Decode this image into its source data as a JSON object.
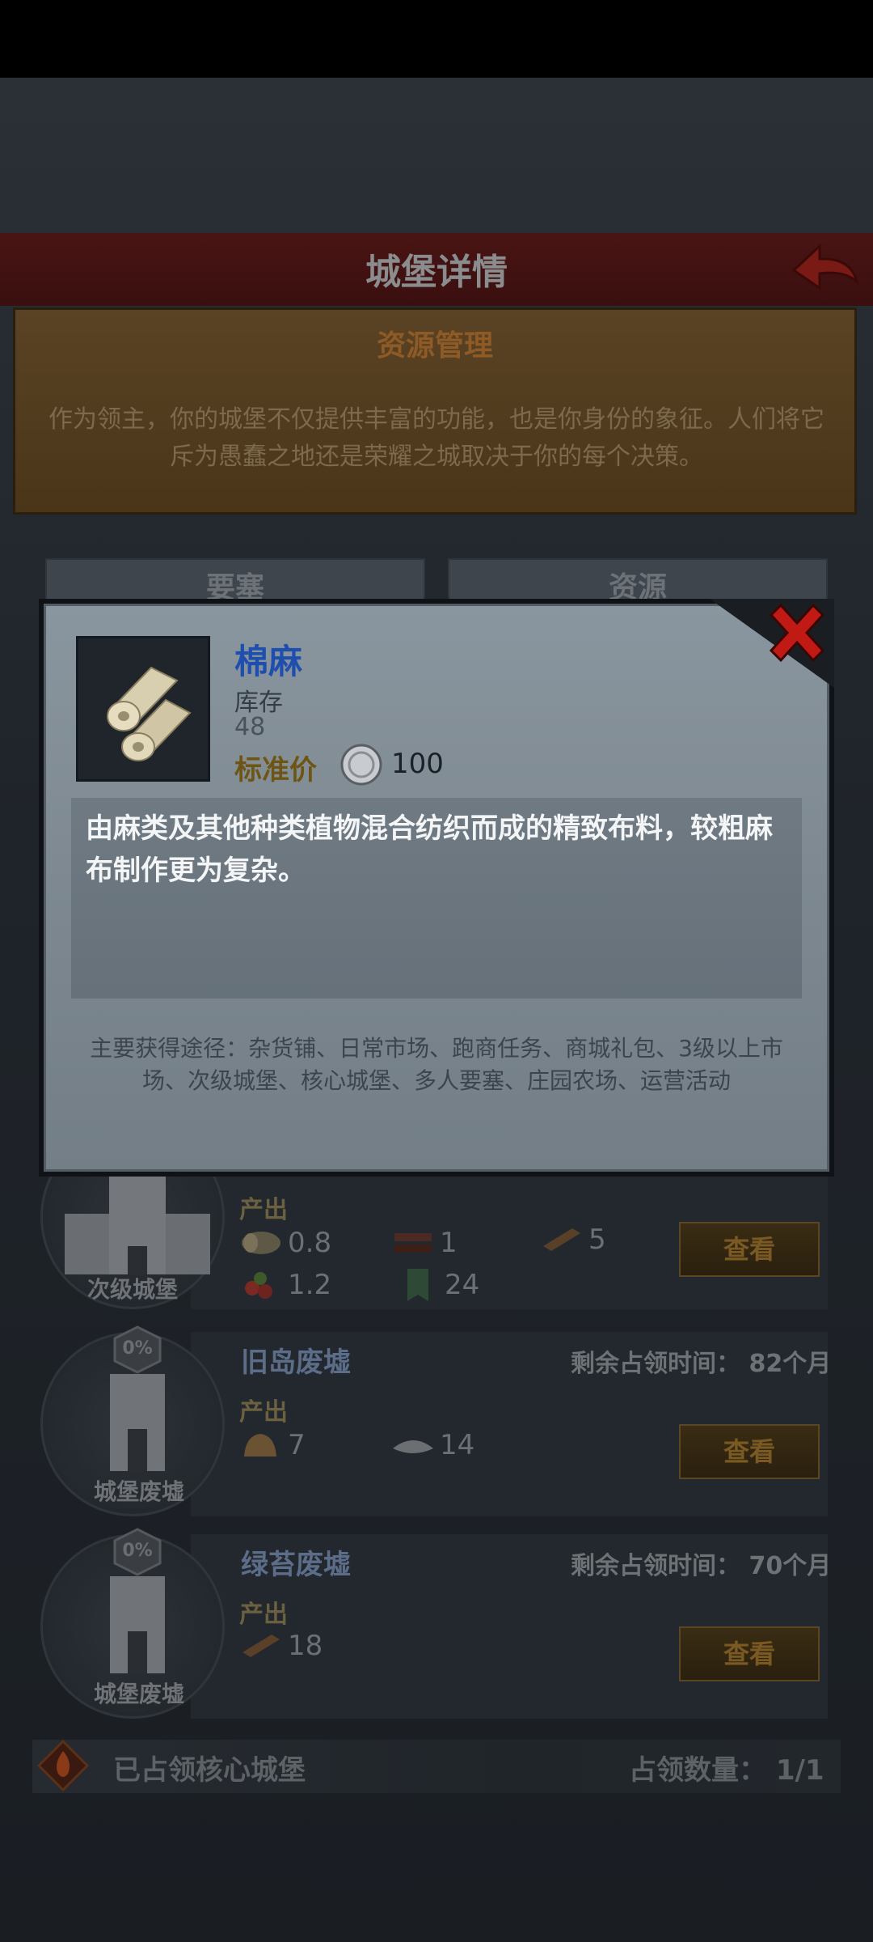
{
  "screen": {
    "title": "城堡详情",
    "resource_mgmt": {
      "title": "资源管理",
      "text": "作为领主，你的城堡不仅提供丰富的功能，也是你身份的象征。人们将它斥为愚蠢之地还是荣耀之城取决于你的每个决策。"
    },
    "tabs": [
      "要塞",
      "资源"
    ]
  },
  "castles": [
    {
      "label": "次级城堡",
      "produce_label": "产出",
      "resources": [
        {
          "icon": "wood-log-icon",
          "value": "0.8"
        },
        {
          "icon": "timber-icon",
          "value": "1"
        },
        {
          "icon": "plank-icon",
          "value": "5"
        },
        {
          "icon": "berry-icon",
          "value": "1.2"
        },
        {
          "icon": "banner-icon",
          "value": "24"
        }
      ],
      "button": "查看"
    },
    {
      "label": "城堡废墟",
      "name": "旧岛废墟",
      "remaining": "剩余占领时间： 82个月",
      "badge": "0%",
      "produce_label": "产出",
      "resources": [
        {
          "icon": "ore-icon",
          "value": "7"
        },
        {
          "icon": "salt-icon",
          "value": "14"
        }
      ],
      "button": "查看"
    },
    {
      "label": "城堡废墟",
      "name": "绿苔废墟",
      "remaining": "剩余占领时间： 70个月",
      "badge": "0%",
      "produce_label": "产出",
      "resources": [
        {
          "icon": "plank-icon",
          "value": "18"
        }
      ],
      "button": "查看"
    }
  ],
  "footer": {
    "left": "已占领核心城堡",
    "right": "占领数量： 1/1"
  },
  "item_popup": {
    "name": "棉麻",
    "stock_label": "库存",
    "stock_value": "48",
    "price_label": "标准价",
    "price_value": "100",
    "description": "由麻类及其他种类植物混合纺织而成的精致布料，较粗麻布制作更为复杂。",
    "sources": "主要获得途径：杂货铺、日常市场、跑商任务、商城礼包、3级以上市场、次级城堡、核心城堡、多人要塞、庄园农场、运营活动"
  },
  "colors": {
    "item_name": "#1f4fae",
    "header_red": "#4a1414",
    "modal_bg": "#8a969f"
  }
}
